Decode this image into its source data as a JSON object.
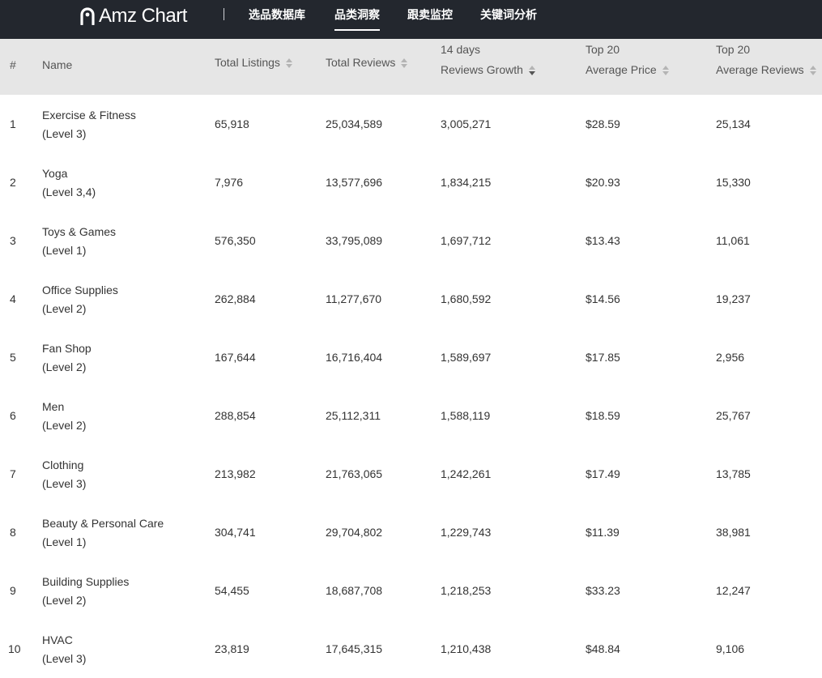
{
  "header": {
    "logo_text": "Amz Chart",
    "nav": [
      {
        "label": "选品数据库",
        "active": false
      },
      {
        "label": "品类洞察",
        "active": true
      },
      {
        "label": "跟卖监控",
        "active": false
      },
      {
        "label": "关键词分析",
        "active": false
      }
    ]
  },
  "table": {
    "columns": {
      "index": "#",
      "name": "Name",
      "listings": "Total Listings",
      "reviews": "Total Reviews",
      "growth_l1": "14 days",
      "growth_l2": "Reviews Growth",
      "price_l1": "Top 20",
      "price_l2": "Average Price",
      "avgrev_l1": "Top 20",
      "avgrev_l2": "Average Reviews"
    },
    "rows": [
      {
        "idx": "1",
        "name": "Exercise & Fitness",
        "level": "(Level 3)",
        "listings": "65,918",
        "reviews": "25,034,589",
        "growth": "3,005,271",
        "price": "$28.59",
        "avg_reviews": "25,134"
      },
      {
        "idx": "2",
        "name": "Yoga",
        "level": "(Level 3,4)",
        "listings": "7,976",
        "reviews": "13,577,696",
        "growth": "1,834,215",
        "price": "$20.93",
        "avg_reviews": "15,330"
      },
      {
        "idx": "3",
        "name": "Toys & Games",
        "level": "(Level 1)",
        "listings": "576,350",
        "reviews": "33,795,089",
        "growth": "1,697,712",
        "price": "$13.43",
        "avg_reviews": "11,061"
      },
      {
        "idx": "4",
        "name": "Office Supplies",
        "level": "(Level 2)",
        "listings": "262,884",
        "reviews": "11,277,670",
        "growth": "1,680,592",
        "price": "$14.56",
        "avg_reviews": "19,237"
      },
      {
        "idx": "5",
        "name": "Fan Shop",
        "level": "(Level 2)",
        "listings": "167,644",
        "reviews": "16,716,404",
        "growth": "1,589,697",
        "price": "$17.85",
        "avg_reviews": "2,956"
      },
      {
        "idx": "6",
        "name": "Men",
        "level": "(Level 2)",
        "listings": "288,854",
        "reviews": "25,112,311",
        "growth": "1,588,119",
        "price": "$18.59",
        "avg_reviews": "25,767"
      },
      {
        "idx": "7",
        "name": "Clothing",
        "level": "(Level 3)",
        "listings": "213,982",
        "reviews": "21,763,065",
        "growth": "1,242,261",
        "price": "$17.49",
        "avg_reviews": "13,785"
      },
      {
        "idx": "8",
        "name": "Beauty & Personal Care",
        "level": "(Level 1)",
        "listings": "304,741",
        "reviews": "29,704,802",
        "growth": "1,229,743",
        "price": "$11.39",
        "avg_reviews": "38,981"
      },
      {
        "idx": "9",
        "name": "Building Supplies",
        "level": "(Level 2)",
        "listings": "54,455",
        "reviews": "18,687,708",
        "growth": "1,218,253",
        "price": "$33.23",
        "avg_reviews": "12,247"
      },
      {
        "idx": "10",
        "name": "HVAC",
        "level": "(Level 3)",
        "listings": "23,819",
        "reviews": "17,645,315",
        "growth": "1,210,438",
        "price": "$48.84",
        "avg_reviews": "9,106"
      }
    ]
  }
}
